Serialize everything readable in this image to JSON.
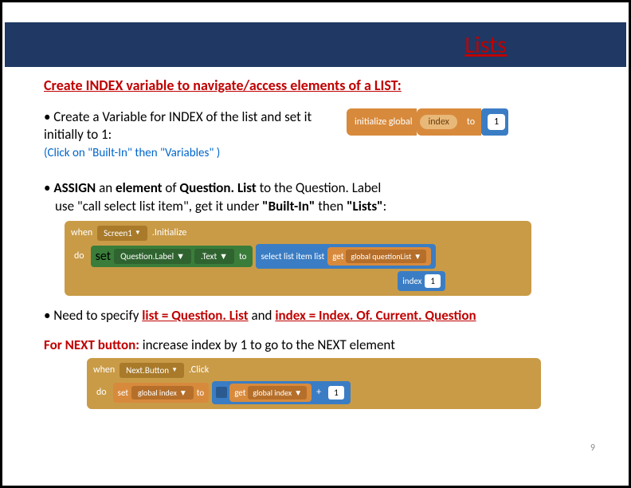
{
  "title": "Lists",
  "subheading": "Create INDEX variable to navigate/access elements of a LIST:",
  "bullet1": {
    "prefix": "• Create a Variable for INDEX of the list and set it initially to 1:",
    "note": "(Click on \"Built-In\" then \"Variables\" )"
  },
  "block1": {
    "init": "initialize global",
    "name": "index",
    "to": "to",
    "value": "1"
  },
  "bullet2": {
    "l1a": "•  ",
    "l1b": "ASSIGN",
    "l1c": " an ",
    "l1d": "element",
    "l1e": " of ",
    "l1f": "Question. List",
    "l1g": " to the Question. Label",
    "l2": "use \"call select list item\", get it under \"Built-In\" then \"Lists\":"
  },
  "block2": {
    "when": "when",
    "screen": "Screen1",
    "init": ".Initialize",
    "do": "do",
    "set": "set",
    "ql": "Question.Label",
    "text": ".Text",
    "to": "to",
    "select": "select list item  list",
    "get": "get",
    "gql": "global questionList",
    "index": "index",
    "num": "1"
  },
  "bullet3": {
    "a": "• Need to specify ",
    "b": "list = Question. List",
    "c": " and ",
    "d": "index = Index. Of. Current. Question"
  },
  "bullet4": {
    "a": "For NEXT button:",
    "b": "  increase index by 1 to go to the NEXT element"
  },
  "block3": {
    "when": "when",
    "btn": "Next.Button",
    "click": ".Click",
    "do": "do",
    "set": "set",
    "gi": "global index",
    "to": "to",
    "get": "get",
    "gi2": "global index",
    "plus": "+",
    "num": "1"
  },
  "slide_number": "9"
}
